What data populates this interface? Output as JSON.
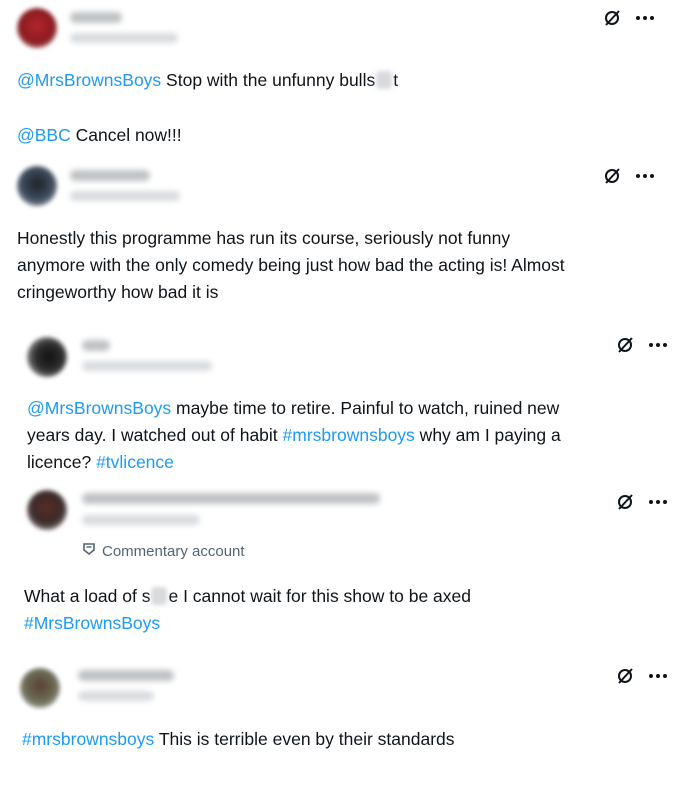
{
  "posts": [
    {
      "text_lines": [
        {
          "mention": "@MrsBrownsBoys",
          "rest": " Stop with the unfunny bulls",
          "tail": "t"
        },
        {
          "mention": "@BBC",
          "rest": "  Cancel now!!!"
        }
      ]
    },
    {
      "text_lines": [
        "Honestly this programme has run its course, seriously not funny",
        "anymore with the only comedy being just how bad the acting is! Almost",
        "cringeworthy how bad it is"
      ]
    },
    {
      "line1": {
        "mention": "@MrsBrownsBoys",
        "rest": " maybe time to retire. Painful to watch, ruined new"
      },
      "line2": {
        "pre": "years day. I watched out of habit ",
        "hashtag": "#mrsbrownsboys",
        "rest": " why am I paying a"
      },
      "line3": {
        "pre": "licence? ",
        "hashtag": "#tvlicence"
      }
    },
    {
      "badge": "Commentary account",
      "line1": {
        "pre": "What a load of s",
        "post": "e I cannot wait for this show to be axed"
      },
      "line2": {
        "hashtag": "#MrsBrownsBoys"
      }
    },
    {
      "line1": {
        "hashtag": "#mrsbrownsboys",
        "rest": " This is terrible even by their standards"
      }
    }
  ],
  "icons": {
    "grok": "grok-icon",
    "more": "more-icon",
    "commentary": "commentary-badge-icon"
  },
  "colors": {
    "link": "#1d9bf0",
    "text": "#0f1419",
    "secondary": "#536471"
  }
}
